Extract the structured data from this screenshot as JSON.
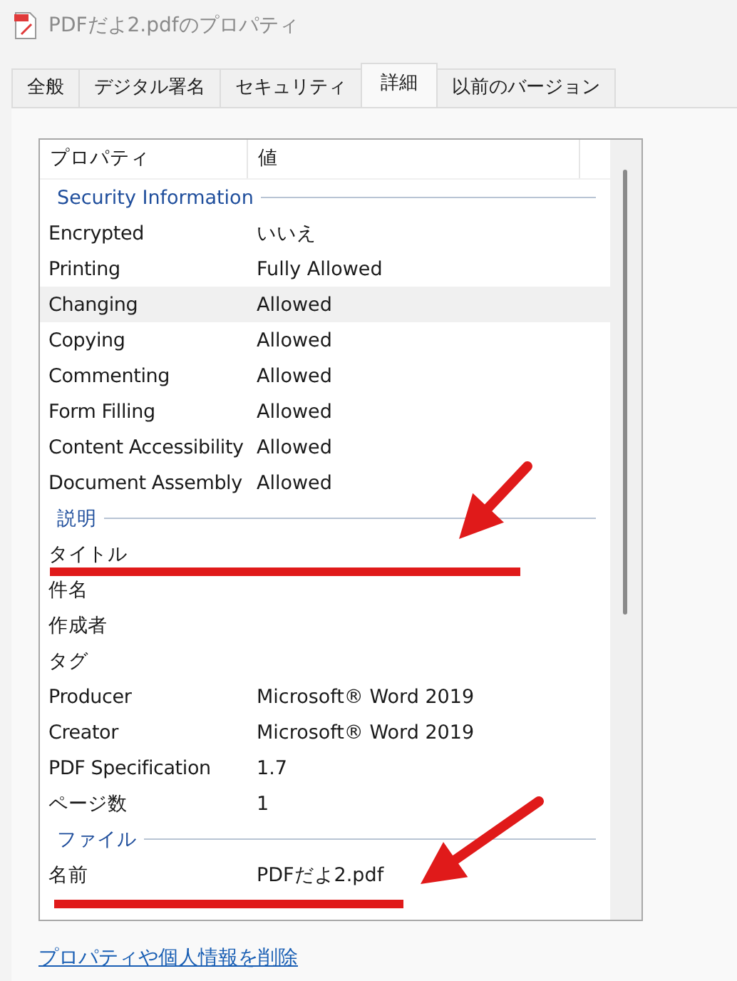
{
  "window": {
    "title": "PDFだよ2.pdfのプロパティ"
  },
  "tabs": [
    {
      "label": "全般",
      "selected": false
    },
    {
      "label": "デジタル署名",
      "selected": false
    },
    {
      "label": "セキュリティ",
      "selected": false
    },
    {
      "label": "詳細",
      "selected": true
    },
    {
      "label": "以前のバージョン",
      "selected": false
    }
  ],
  "list": {
    "columns": [
      "プロパティ",
      "値"
    ],
    "groups": [
      {
        "title": "Security Information",
        "rows": [
          {
            "property": "Encrypted",
            "value": "いいえ",
            "selected": false
          },
          {
            "property": "Printing",
            "value": "Fully Allowed",
            "selected": false
          },
          {
            "property": "Changing",
            "value": "Allowed",
            "selected": true
          },
          {
            "property": "Copying",
            "value": "Allowed",
            "selected": false
          },
          {
            "property": "Commenting",
            "value": "Allowed",
            "selected": false
          },
          {
            "property": "Form Filling",
            "value": "Allowed",
            "selected": false
          },
          {
            "property": "Content Accessibility",
            "value": "Allowed",
            "selected": false
          },
          {
            "property": "Document Assembly",
            "value": "Allowed",
            "selected": false
          }
        ]
      },
      {
        "title": "説明",
        "rows": [
          {
            "property": "タイトル",
            "selected": false
          },
          {
            "property": "件名",
            "selected": false
          },
          {
            "property": "作成者",
            "selected": false
          },
          {
            "property": "タグ",
            "selected": false
          },
          {
            "property": "Producer",
            "value": "Microsoft® Word 2019",
            "selected": false
          },
          {
            "property": "Creator",
            "value": "Microsoft® Word 2019",
            "selected": false
          },
          {
            "property": "PDF Specification",
            "value": "1.7",
            "selected": false
          },
          {
            "property": "ページ数",
            "value": "1",
            "selected": false
          }
        ]
      },
      {
        "title": "ファイル",
        "rows": [
          {
            "property": "名前",
            "value": "PDFだよ2.pdf",
            "selected": false
          }
        ]
      }
    ]
  },
  "link": "プロパティや個人情報を削除",
  "annotations": [
    {
      "kind": "arrow"
    },
    {
      "kind": "underline"
    },
    {
      "kind": "arrow"
    },
    {
      "kind": "underline"
    }
  ]
}
